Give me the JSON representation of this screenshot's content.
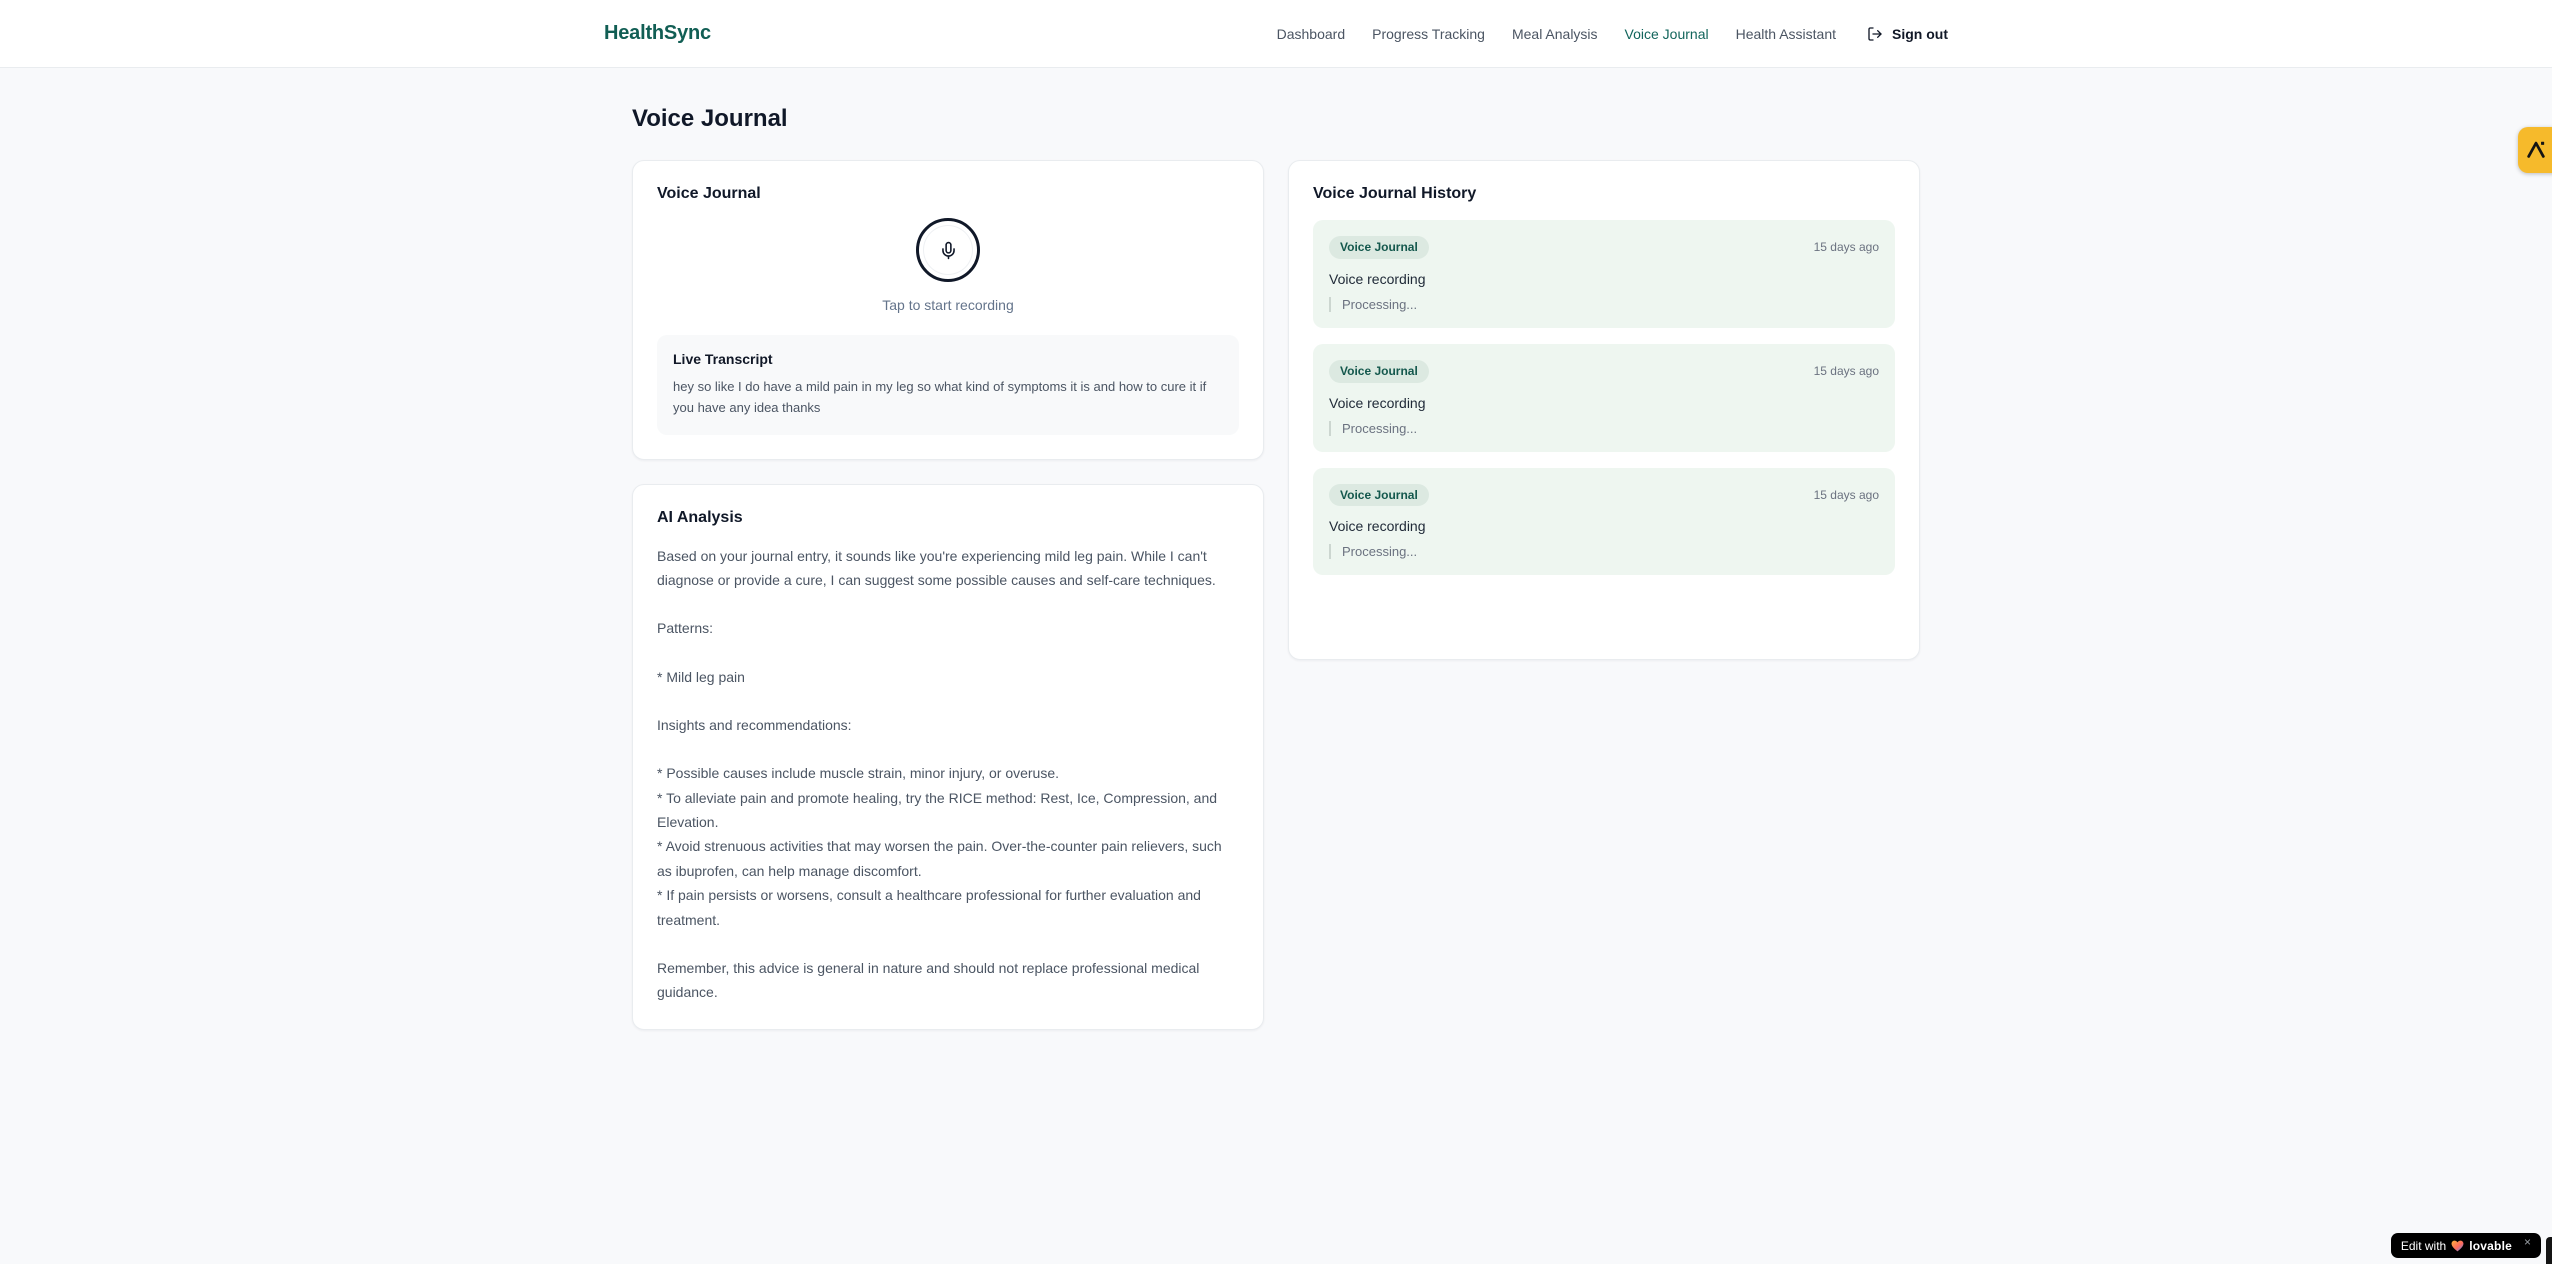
{
  "brand": {
    "name": "HealthSync"
  },
  "nav": {
    "items": [
      {
        "label": "Dashboard",
        "active": false
      },
      {
        "label": "Progress Tracking",
        "active": false
      },
      {
        "label": "Meal Analysis",
        "active": false
      },
      {
        "label": "Voice Journal",
        "active": true
      },
      {
        "label": "Health Assistant",
        "active": false
      }
    ],
    "sign_out_label": "Sign out"
  },
  "page": {
    "title": "Voice Journal"
  },
  "recorder": {
    "title": "Voice Journal",
    "tap_hint": "Tap to start recording",
    "transcript": {
      "title": "Live Transcript",
      "text": "hey so like I do have a mild pain in my leg so what kind of symptoms it is and how to cure it if you have any idea thanks"
    }
  },
  "analysis": {
    "title": "AI Analysis",
    "paragraphs": [
      "Based on your journal entry, it sounds like you're experiencing mild leg pain. While I can't diagnose or provide a cure, I can suggest some possible causes and self-care techniques.",
      "Patterns:",
      "* Mild leg pain",
      "Insights and recommendations:",
      "* Possible causes include muscle strain, minor injury, or overuse.\n* To alleviate pain and promote healing, try the RICE method: Rest, Ice, Compression, and Elevation.\n* Avoid strenuous activities that may worsen the pain. Over-the-counter pain relievers, such as ibuprofen, can help manage discomfort.\n* If pain persists or worsens, consult a healthcare professional for further evaluation and treatment.",
      "Remember, this advice is general in nature and should not replace professional medical guidance."
    ]
  },
  "history": {
    "title": "Voice Journal History",
    "entries": [
      {
        "badge": "Voice Journal",
        "time": "15 days ago",
        "label": "Voice recording",
        "status": "Processing..."
      },
      {
        "badge": "Voice Journal",
        "time": "15 days ago",
        "label": "Voice recording",
        "status": "Processing..."
      },
      {
        "badge": "Voice Journal",
        "time": "15 days ago",
        "label": "Voice recording",
        "status": "Processing..."
      }
    ]
  },
  "floating": {
    "lovable_prefix": "Edit with",
    "lovable_brand": "lovable",
    "lovable_close": "×"
  },
  "colors": {
    "brand_teal": "#115e54",
    "nav_active": "#12655c",
    "page_bg": "#f8f9fb",
    "history_entry_bg": "#eef6f0",
    "badge_bg": "#dce9e1",
    "badge_text": "#14584d",
    "side_badge_amber": "#f6ba2b",
    "lovable_bg": "#000000"
  }
}
